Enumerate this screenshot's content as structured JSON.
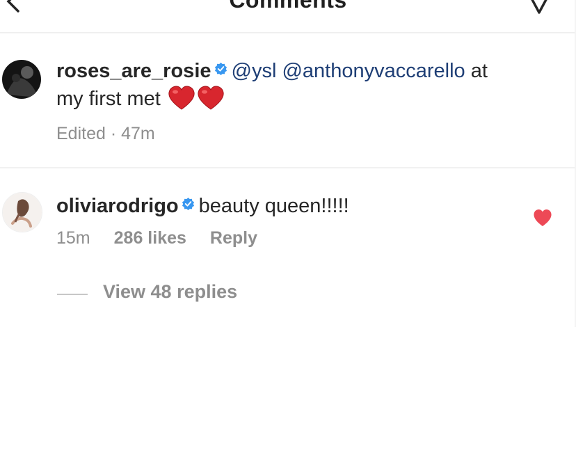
{
  "header": {
    "title": "Comments",
    "back_icon": "back-chevron-icon",
    "dm_icon": "paper-plane-icon"
  },
  "comments": [
    {
      "username": "roses_are_rosie",
      "verified": true,
      "mentions": [
        "@ysl",
        "@anthonyvaccarello"
      ],
      "text_line1_suffix": "at",
      "text_line2": "my first met",
      "emoji": [
        "red-heart",
        "red-heart"
      ],
      "meta": "Edited · 47m"
    },
    {
      "username": "oliviarodrigo",
      "verified": true,
      "text": "beauty queen!!!!!",
      "time": "15m",
      "likes": "286 likes",
      "reply_label": "Reply",
      "liked": true,
      "view_replies": "View 48 replies"
    }
  ],
  "colors": {
    "mention": "#1e3e75",
    "verified": "#3897f0",
    "like": "#ed4956",
    "muted": "#8e8e8e"
  }
}
